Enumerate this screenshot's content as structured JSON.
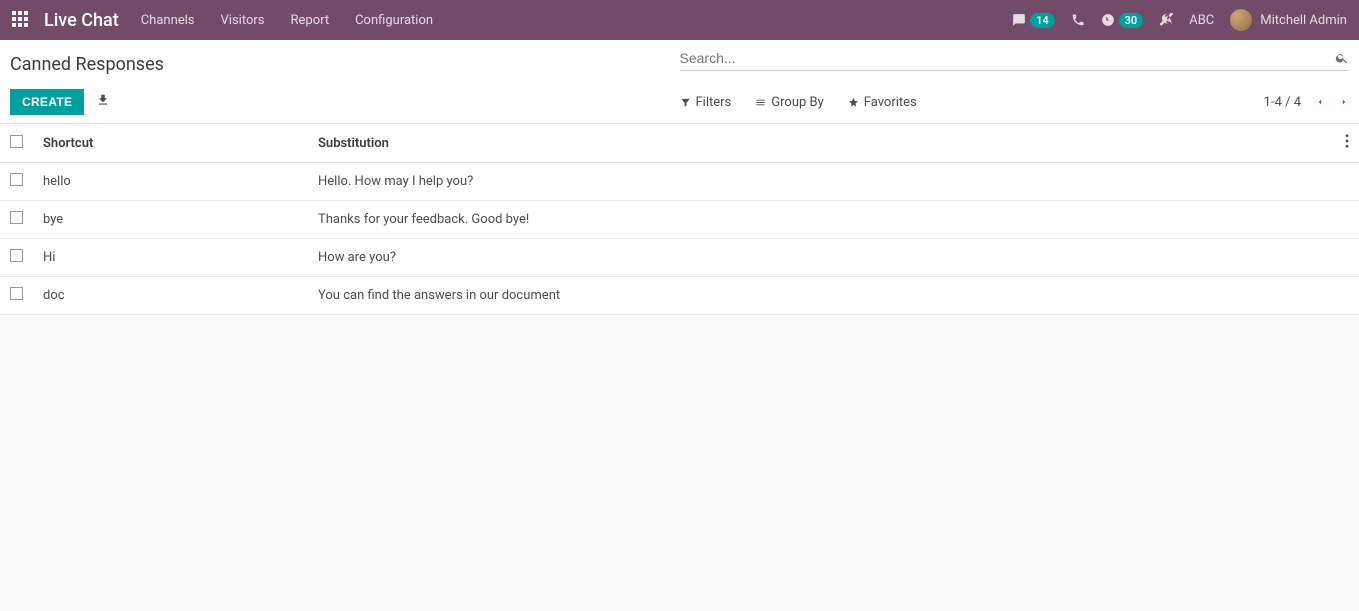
{
  "nav": {
    "brand": "Live Chat",
    "items": [
      "Channels",
      "Visitors",
      "Report",
      "Configuration"
    ],
    "chat_badge": "14",
    "clock_badge": "30",
    "abc": "ABC",
    "user_name": "Mitchell Admin"
  },
  "breadcrumb": "Canned Responses",
  "search": {
    "placeholder": "Search..."
  },
  "toolbar": {
    "create_label": "CREATE",
    "filters_label": "Filters",
    "groupby_label": "Group By",
    "favorites_label": "Favorites"
  },
  "pager": {
    "text": "1-4 / 4"
  },
  "columns": {
    "shortcut": "Shortcut",
    "substitution": "Substitution"
  },
  "rows": [
    {
      "shortcut": "hello",
      "substitution": "Hello. How may I help you?"
    },
    {
      "shortcut": "bye",
      "substitution": "Thanks for your feedback. Good bye!"
    },
    {
      "shortcut": "Hi",
      "substitution": "How are you?"
    },
    {
      "shortcut": "doc",
      "substitution": "You can find the answers in our document"
    }
  ]
}
